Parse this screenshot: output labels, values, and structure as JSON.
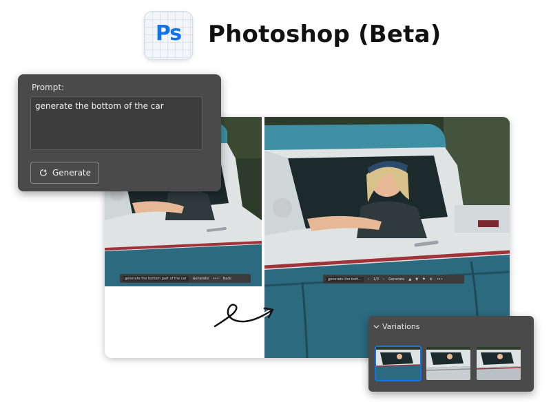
{
  "header": {
    "logo_text": "Ps",
    "app_title": "Photoshop (Beta)"
  },
  "prompt_panel": {
    "label": "Prompt:",
    "prompt_value": "generate the bottom of the car",
    "generate_label": "Generate"
  },
  "comparison": {
    "before_bar": {
      "prompt_value": "generate the bottom part of the car",
      "generate_label": "Generate",
      "back_label": "Back"
    },
    "after_bar": {
      "prompt_value": "generate the bott...",
      "counter": "1/3",
      "generate_label": "Generate"
    }
  },
  "variations_panel": {
    "title": "Variations",
    "selected_index": 0,
    "count": 3
  },
  "colors": {
    "accent": "#1473e6",
    "panel_bg": "#4a4a4a",
    "truck_teal": "#2f6b80"
  }
}
